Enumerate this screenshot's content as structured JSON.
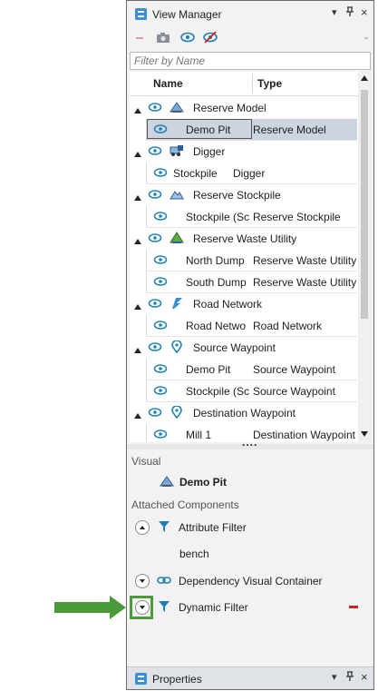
{
  "view_manager": {
    "title": "View Manager",
    "controls": {
      "dropdown": "▾",
      "pin": "ꟷ",
      "close": "×"
    },
    "toolbar": {
      "remove_icon": "minus-icon",
      "camera_icon": "camera-icon",
      "show_icon": "eye-icon",
      "hide_icon": "eye-slash-icon",
      "overflow": "⌄"
    },
    "filter": {
      "placeholder": "Filter by Name",
      "value": ""
    },
    "columns": {
      "name": "Name",
      "type": "Type"
    },
    "groups": [
      {
        "label": "Reserve Model",
        "icon": "reserve-model-icon",
        "children": [
          {
            "name": "Demo Pit",
            "type": "Reserve Model",
            "selected": true
          }
        ]
      },
      {
        "label": "Digger",
        "icon": "digger-icon",
        "children": [
          {
            "name": "Stockpile",
            "type": "Digger"
          }
        ]
      },
      {
        "label": "Reserve Stockpile",
        "icon": "stockpile-icon",
        "children": [
          {
            "name": "Stockpile (Sc",
            "type": "Reserve Stockpile"
          }
        ]
      },
      {
        "label": "Reserve Waste Utility",
        "icon": "waste-utility-icon",
        "children": [
          {
            "name": "North Dump",
            "type": "Reserve Waste Utility"
          },
          {
            "name": "South Dump",
            "type": "Reserve Waste Utility"
          }
        ]
      },
      {
        "label": "Road Network",
        "icon": "road-network-icon",
        "children": [
          {
            "name": "Road Netwo",
            "type": "Road Network"
          }
        ]
      },
      {
        "label": "Source Waypoint",
        "icon": "waypoint-icon",
        "children": [
          {
            "name": "Demo Pit",
            "type": "Source Waypoint"
          },
          {
            "name": "Stockpile (Sc",
            "type": "Source Waypoint"
          }
        ]
      },
      {
        "label": "Destination Waypoint",
        "icon": "waypoint-icon",
        "children": [
          {
            "name": "Mill 1",
            "type": "Destination Waypoint"
          }
        ]
      }
    ],
    "splitter_grip": "....",
    "visual": {
      "section_label": "Visual",
      "selected_name": "Demo Pit"
    },
    "attached": {
      "section_label": "Attached Components",
      "components": [
        {
          "label": "Attribute Filter",
          "expanded": true,
          "detail": "bench"
        },
        {
          "label": "Dependency Visual Container",
          "expanded": false
        },
        {
          "label": "Dynamic Filter",
          "expanded": false,
          "removable": true
        }
      ]
    }
  },
  "properties": {
    "title": "Properties",
    "controls": {
      "dropdown": "▾",
      "pin": "ꟷ",
      "close": "×"
    }
  },
  "colors": {
    "accent_blue": "#3a8fd6",
    "eye_teal": "#1f7fb0",
    "selection": "#ccd4e0",
    "callout_green": "#4c9b3a",
    "remove_red": "#d02020"
  }
}
